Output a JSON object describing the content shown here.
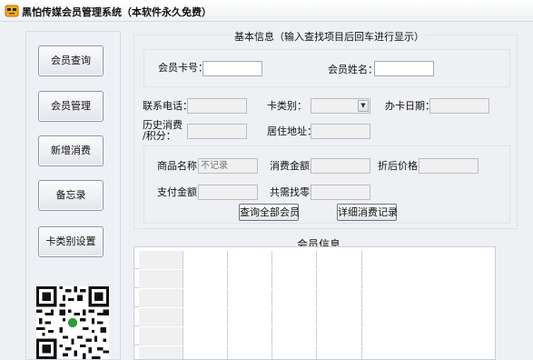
{
  "window": {
    "title": "黑怕传媒会员管理系统（本软件永久免费）"
  },
  "sidebar": {
    "buttons": [
      {
        "label": "会员查询"
      },
      {
        "label": "会员管理"
      },
      {
        "label": "新增消费"
      },
      {
        "label": "备忘录"
      },
      {
        "label": "卡类别设置"
      }
    ]
  },
  "basic_info": {
    "title": "基本信息（输入查找项目后回车进行显示）",
    "card_no_label": "会员卡号：",
    "card_no_value": "",
    "name_label": "会员姓名：",
    "name_value": "",
    "phone_label": "联系电话：",
    "phone_value": "",
    "card_type_label": "卡类别：",
    "card_type_value": "",
    "issue_date_label": "办卡日期：",
    "issue_date_value": "",
    "history_label_line1": "历史消费",
    "history_label_line2": "/积分：",
    "history_value": "",
    "address_label": "居住地址：",
    "address_value": "",
    "product_label": "商品名称:",
    "product_placeholder": "不记录",
    "amount_label": "消费金额：",
    "amount_value": "",
    "discount_label": "折后价格：",
    "discount_value": "",
    "pay_label": "支付金额：",
    "pay_value": "",
    "change_label": "共需找零：",
    "change_value": "",
    "query_all_button": "查询全部会员",
    "detail_button": "详细消费记录"
  },
  "member_info": {
    "title": "会员信息",
    "columns": [
      "",
      "",
      "",
      "",
      ""
    ],
    "rows": [
      [
        "",
        "",
        "",
        "",
        ""
      ],
      [
        "",
        "",
        "",
        "",
        ""
      ],
      [
        "",
        "",
        "",
        "",
        ""
      ],
      [
        "",
        "",
        "",
        "",
        ""
      ],
      [
        "",
        "",
        "",
        "",
        ""
      ]
    ]
  }
}
